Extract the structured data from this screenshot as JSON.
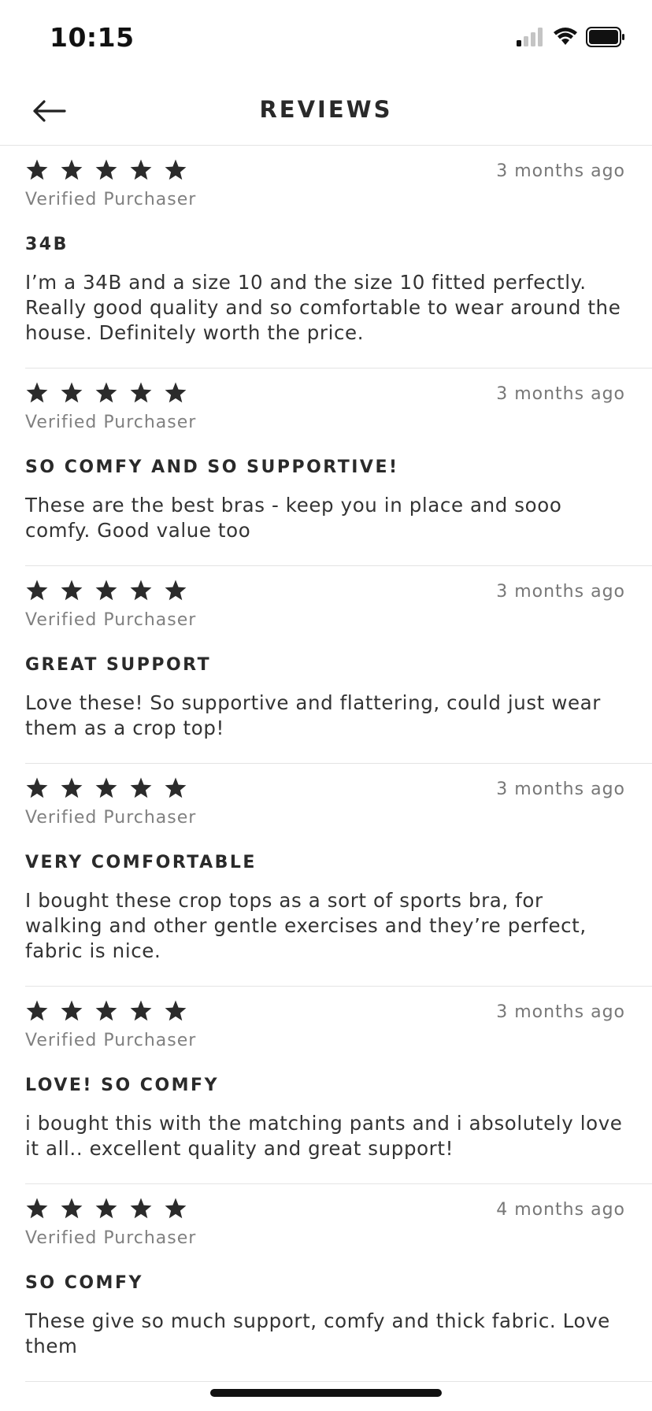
{
  "status_bar": {
    "time": "10:15",
    "icons": [
      "signal-icon",
      "wifi-icon",
      "battery-icon"
    ]
  },
  "header": {
    "title": "REVIEWS",
    "back_icon": "arrow-left-icon"
  },
  "reviews": [
    {
      "rating": 5,
      "date": "3 months ago",
      "verified": "Verified Purchaser",
      "title": "34B",
      "body": "I’m a 34B and a size 10 and the size 10 fitted perfectly. Really good quality and so comfortable to wear around the house. Definitely worth the price."
    },
    {
      "rating": 5,
      "date": "3 months ago",
      "verified": "Verified Purchaser",
      "title": "SO COMFY AND SO SUPPORTIVE!",
      "body": "These are the best bras - keep you in place and sooo comfy. Good value too"
    },
    {
      "rating": 5,
      "date": "3 months ago",
      "verified": "Verified Purchaser",
      "title": "GREAT SUPPORT",
      "body": "Love these! So supportive and flattering, could just wear them as a crop top!"
    },
    {
      "rating": 5,
      "date": "3 months ago",
      "verified": "Verified Purchaser",
      "title": "VERY COMFORTABLE",
      "body": "I bought these crop tops as a sort of sports bra, for walking and other gentle exercises and they’re perfect, fabric is nice."
    },
    {
      "rating": 5,
      "date": "3 months ago",
      "verified": "Verified Purchaser",
      "title": "LOVE! SO COMFY",
      "body": "i bought this with the matching pants and i absolutely love it all.. excellent quality and great support!"
    },
    {
      "rating": 5,
      "date": "4 months ago",
      "verified": "Verified Purchaser",
      "title": "SO COMFY",
      "body": "These give so much support, comfy and thick fabric. Love them"
    }
  ],
  "colors": {
    "star": "#2b2b2b",
    "divider": "#e4e4e4",
    "muted_text": "#777777"
  }
}
